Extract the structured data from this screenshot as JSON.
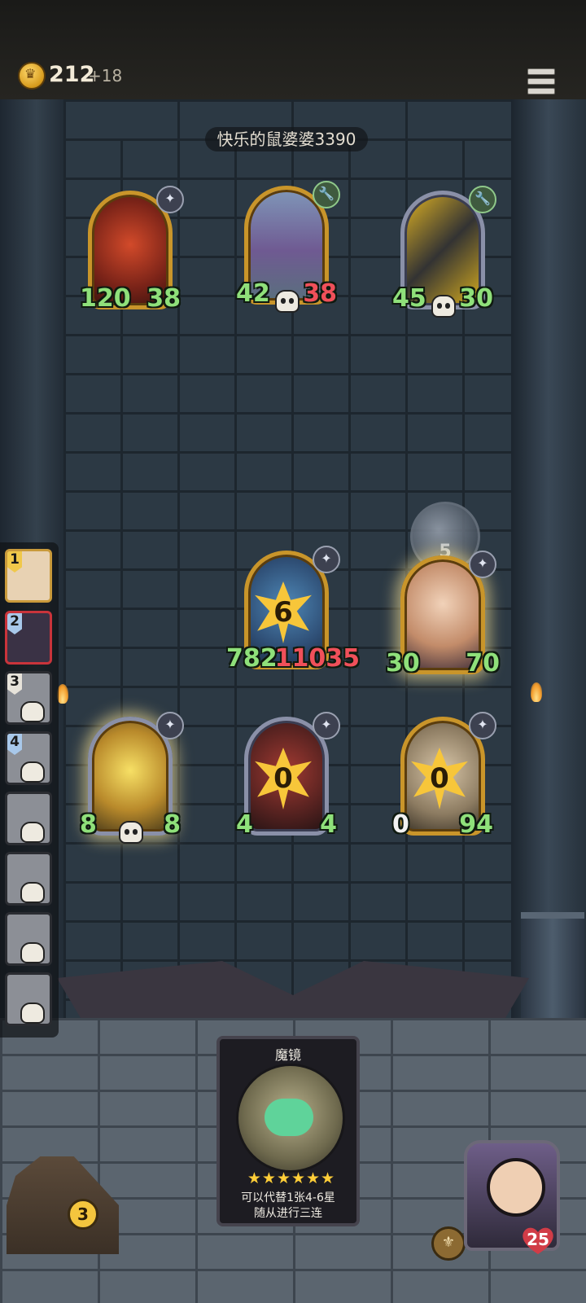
{
  "header": {
    "gold": "212",
    "gold_income": "+18"
  },
  "opponent": {
    "name": "快乐的鼠婆婆3390"
  },
  "opponent_board": [
    {
      "atk": "120",
      "hp": "38"
    },
    {
      "atk": "42",
      "hp": "38"
    },
    {
      "atk": "45",
      "hp": "30"
    }
  ],
  "player_board": [
    {
      "level": "6",
      "atk": "782",
      "hp": "11035"
    },
    {
      "atk": "30",
      "hp": "70"
    },
    {
      "atk": "8",
      "hp": "8"
    },
    {
      "level": "0",
      "atk": "4",
      "hp": "4"
    },
    {
      "level": "0",
      "atk": "0",
      "hp": "94"
    }
  ],
  "timer_orb": "5",
  "player_list": [
    {
      "rank": "1"
    },
    {
      "rank": "2"
    },
    {
      "rank": "3"
    },
    {
      "rank": "4"
    }
  ],
  "card": {
    "title": "魔镜",
    "stars": "★★★★★★",
    "desc_line1": "可以代替1张4-6星",
    "desc_line2": "随从进行三连"
  },
  "shop": {
    "count": "3"
  },
  "hero": {
    "hp": "25"
  },
  "colors": {
    "attack_green": "#8fe07a",
    "damage_red": "#f0505a",
    "gold_frame": "#c9952a"
  }
}
